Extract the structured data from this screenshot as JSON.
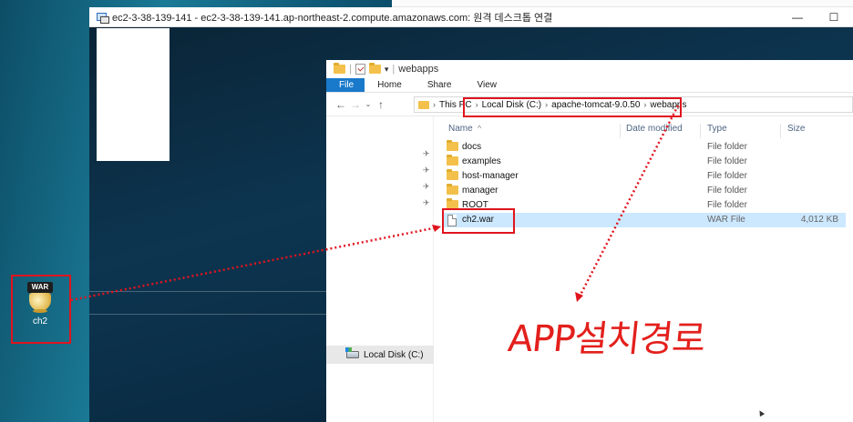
{
  "remote_window": {
    "title": "ec2-3-38-139-141 - ec2-3-38-139-141.ap-northeast-2.compute.amazonaws.com: 원격 데스크톱 연결",
    "minimize_glyph": "—",
    "maximize_glyph": "☐"
  },
  "explorer": {
    "window_title": "webapps",
    "ribbon_tabs": [
      "File",
      "Home",
      "Share",
      "View"
    ],
    "breadcrumb": [
      "This PC",
      "Local Disk (C:)",
      "apache-tomcat-9.0.50",
      "webapps"
    ],
    "columns": [
      "Name",
      "Date modified",
      "Type",
      "Size"
    ],
    "files": [
      {
        "name": "docs",
        "type": "File folder",
        "size": "",
        "kind": "folder"
      },
      {
        "name": "examples",
        "type": "File folder",
        "size": "",
        "kind": "folder"
      },
      {
        "name": "host-manager",
        "type": "File folder",
        "size": "",
        "kind": "folder"
      },
      {
        "name": "manager",
        "type": "File folder",
        "size": "",
        "kind": "folder"
      },
      {
        "name": "ROOT",
        "type": "File folder",
        "size": "",
        "kind": "folder"
      },
      {
        "name": "ch2.war",
        "type": "WAR File",
        "size": "4,012 KB",
        "kind": "file",
        "selected": true
      }
    ],
    "nav_pane": {
      "local_disk": "Local Disk (C:)"
    }
  },
  "desktop": {
    "war_icon": {
      "badge": "WAR",
      "label": "ch2"
    }
  },
  "annotation": {
    "text": "APP설치경로",
    "color": "#e0141e"
  },
  "colors": {
    "file_tab": "#1979ca",
    "selection": "#cce8ff",
    "annotation_red": "#e0141e"
  }
}
